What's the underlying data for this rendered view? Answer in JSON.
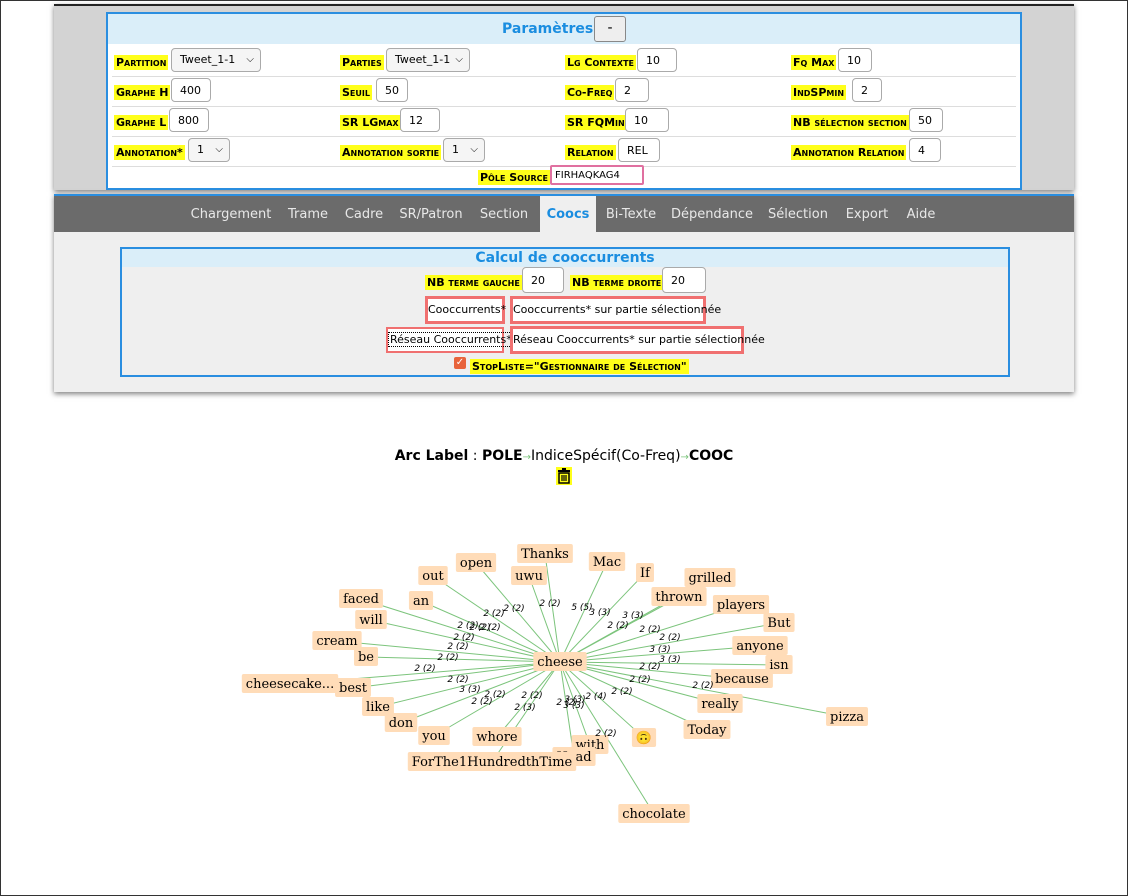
{
  "params": {
    "title": "Paramètres",
    "toggle_label": "-",
    "partition": {
      "label": "Partition",
      "value": "Tweet_1-1"
    },
    "parties": {
      "label": "Parties",
      "value": "Tweet_1-1"
    },
    "lg_contexte": {
      "label": "Lg Contexte",
      "value": "10"
    },
    "fq_max": {
      "label": "Fq Max",
      "value": "10"
    },
    "graphe_h": {
      "label": "Graphe H",
      "value": "400"
    },
    "seuil": {
      "label": "Seuil",
      "value": "50"
    },
    "co_freq": {
      "label": "Co-Freq",
      "value": "2"
    },
    "indspmin": {
      "label": "IndSPmin",
      "value": "2"
    },
    "graphe_l": {
      "label": "Graphe L",
      "value": "800"
    },
    "sr_lgmax": {
      "label": "SR LGmax",
      "value": "12"
    },
    "sr_fqmin": {
      "label": "SR FQMin",
      "value": "10"
    },
    "nb_selection_section": {
      "label": "NB sélection section",
      "value": "50"
    },
    "annotation": {
      "label": "Annotation*",
      "value": "1"
    },
    "annotation_sortie": {
      "label": "Annotation sortie",
      "value": "1"
    },
    "relation": {
      "label": "Relation",
      "value": "REL"
    },
    "annotation_relation": {
      "label": "Annotation Relation",
      "value": "4"
    },
    "pole_source": {
      "label": "Pôle Source",
      "value": "FIRHAQKAG4"
    }
  },
  "tabs": [
    "Chargement",
    "Trame",
    "Cadre",
    "SR/Patron",
    "Section",
    "Coocs",
    "Bi-Texte",
    "Dépendance",
    "Sélection",
    "Export",
    "Aide"
  ],
  "active_tab": "Coocs",
  "cooc": {
    "title": "Calcul de cooccurrents",
    "nb_terme_gauche": {
      "label": "NB terme gauche",
      "value": "20"
    },
    "nb_terme_droite": {
      "label": "NB terme droite",
      "value": "20"
    },
    "btn_cooccurrents": "Cooccurrents*",
    "btn_cooccurrents_partie": "Cooccurrents* sur partie sélectionnée",
    "btn_reseau": "Réseau Cooccurrents*",
    "btn_reseau_partie": "Réseau Cooccurrents* sur partie sélectionnée",
    "stopliste": "StopListe=\"Gestionnaire de Sélection\"",
    "stopliste_checked": true
  },
  "arc_label": {
    "prefix": "Arc Label",
    "sep": " : ",
    "pole": "POLE",
    "arrow1": "→",
    "indice": "IndiceSpécif(Co-Freq)",
    "arrow2": "→",
    "cooc": "COOC"
  },
  "icons": {
    "trash": "trash-icon",
    "checkbox": "checkbox-icon"
  },
  "colors": {
    "accent": "#2a8ee0",
    "label_bg": "#ffff1a",
    "node_bg": "#ffdcb8",
    "edge": "#7cc47c",
    "button_border": "#f07070"
  },
  "graph": {
    "center": "cheese",
    "nodes": [
      "Thanks",
      "open",
      "uwu",
      "Mac",
      "If",
      "grilled",
      "out",
      "thrown",
      "players",
      "faced",
      "an",
      "will",
      "But",
      "cream",
      "anyone",
      "be",
      "isn",
      "because",
      "cheesecake...",
      "best",
      "like",
      "really",
      "pizza",
      "don",
      "Today",
      "you",
      "whore",
      "with",
      "Head",
      "ForThe1HundredthTime",
      "🙃",
      "chocolate"
    ],
    "edge_labels": [
      "2 (2)",
      "2 (2)",
      "5 (5)",
      "2 (2)",
      "3 (3)",
      "3 (3)",
      "2 (2)",
      "2 (2)",
      "2 (2)",
      "2 (2)",
      "2 (2)",
      "2 (2)",
      "2 (2)",
      "2 (2)",
      "3 (3)",
      "2 (2)",
      "3 (3)",
      "2 (2)",
      "2 (2)",
      "2 (2)",
      "2 (2)",
      "3 (3)",
      "2 (2)",
      "2 (2)",
      "2 (2)",
      "2 (2)",
      "2 (3)",
      "2 (2)",
      "3 (3)",
      "2 (4)",
      "3 (3)",
      "2 (2)",
      "2 (2)"
    ]
  }
}
